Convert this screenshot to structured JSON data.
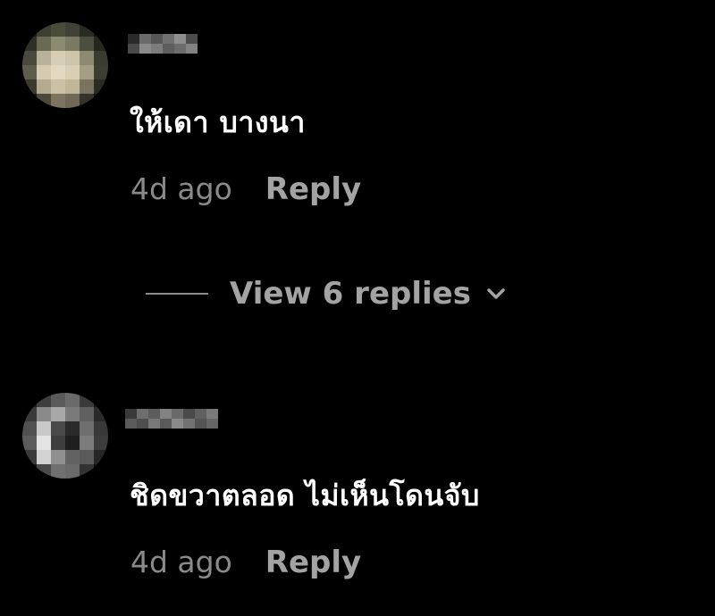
{
  "comments": [
    {
      "text": "ให้เดา บางนา",
      "timestamp": "4d ago",
      "reply_label": "Reply"
    },
    {
      "text": "ชิดขวาตลอด ไม่เห็นโดนจับ",
      "timestamp": "4d ago",
      "reply_label": "Reply"
    }
  ],
  "view_replies": {
    "label": "View 6 replies",
    "icon": "chevron-down-icon"
  },
  "colors": {
    "background": "#000000",
    "comment_text": "#ffffff",
    "timestamp": "#8a8a8a",
    "action_text": "#a3a3a3"
  }
}
